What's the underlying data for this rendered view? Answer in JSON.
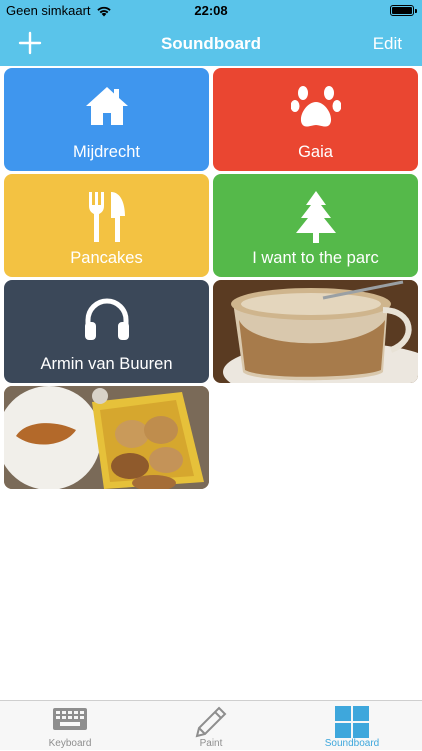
{
  "status_bar": {
    "carrier": "Geen simkaart",
    "time": "22:08"
  },
  "nav": {
    "title": "Soundboard",
    "edit_label": "Edit",
    "add_icon": "plus-icon"
  },
  "tiles": [
    {
      "label": "Mijdrecht",
      "color": "#3f96ee",
      "icon": "house-icon"
    },
    {
      "label": "Gaia",
      "color": "#ea4631",
      "icon": "paw-icon"
    },
    {
      "label": "Pancakes",
      "color": "#f3c242",
      "icon": "fork-knife-icon"
    },
    {
      "label": "I want to the parc",
      "color": "#55b94a",
      "icon": "tree-icon"
    },
    {
      "label": "Armin van Buuren",
      "color": "#3b4859",
      "icon": "headphones-icon"
    },
    {
      "label": "",
      "color": "#c7a37a",
      "icon": "photo-coffee"
    },
    {
      "label": "",
      "color": "#b58a5a",
      "icon": "photo-breakfast"
    }
  ],
  "tabs": [
    {
      "label": "Keyboard",
      "icon": "keyboard-icon",
      "active": false
    },
    {
      "label": "Paint",
      "icon": "pencil-icon",
      "active": false
    },
    {
      "label": "Soundboard",
      "icon": "grid-icon",
      "active": true
    }
  ],
  "colors": {
    "nav_blue": "#5ac4ea",
    "active_tab": "#3ea7dc"
  }
}
